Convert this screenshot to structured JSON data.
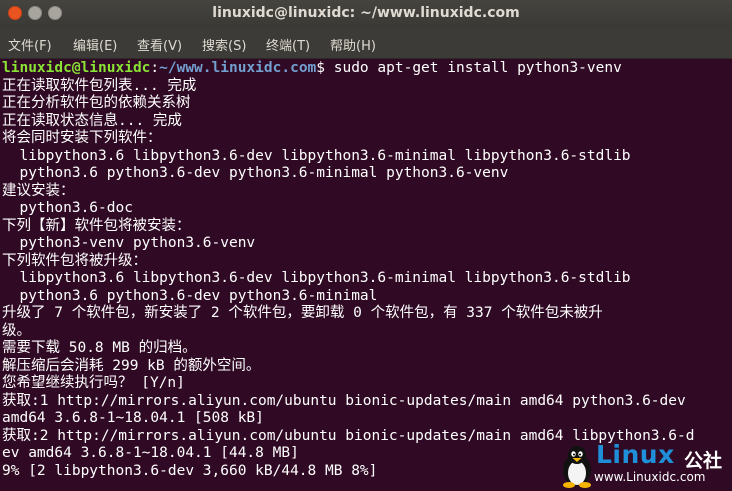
{
  "window": {
    "title": "linuxidc@linuxidc: ~/www.linuxidc.com"
  },
  "menu": [
    "文件(F)",
    "编辑(E)",
    "查看(V)",
    "搜索(S)",
    "终端(T)",
    "帮助(H)"
  ],
  "prompt": {
    "user": "linuxidc@linuxidc",
    "sep": ":",
    "path": "~/www.linuxidc.com",
    "dollar": "$",
    "command": " sudo apt-get install python3-venv"
  },
  "output": [
    "正在读取软件包列表... 完成",
    "正在分析软件包的依赖关系树",
    "正在读取状态信息... 完成",
    "将会同时安装下列软件：",
    "  libpython3.6 libpython3.6-dev libpython3.6-minimal libpython3.6-stdlib",
    "  python3.6 python3.6-dev python3.6-minimal python3.6-venv",
    "建议安装：",
    "  python3.6-doc",
    "下列【新】软件包将被安装：",
    "  python3-venv python3.6-venv",
    "下列软件包将被升级：",
    "  libpython3.6 libpython3.6-dev libpython3.6-minimal libpython3.6-stdlib",
    "  python3.6 python3.6-dev python3.6-minimal",
    "升级了 7 个软件包，新安装了 2 个软件包，要卸载 0 个软件包，有 337 个软件包未被升",
    "级。",
    "需要下载 50.8 MB 的归档。",
    "解压缩后会消耗 299 kB 的额外空间。",
    "您希望继续执行吗？ [Y/n]",
    "获取:1 http://mirrors.aliyun.com/ubuntu bionic-updates/main amd64 python3.6-dev",
    "amd64 3.6.8-1~18.04.1 [508 kB]",
    "获取:2 http://mirrors.aliyun.com/ubuntu bionic-updates/main amd64 libpython3.6-d",
    "ev amd64 3.6.8-1~18.04.1 [44.8 MB]",
    "9% [2 libpython3.6-dev 3,660 kB/44.8 MB 8%]"
  ],
  "watermark": {
    "brand": "Linux",
    "brand_cn": "公社",
    "url": "www.Linuxidc.com"
  },
  "colors": {
    "background": "#300a24",
    "user": "#8ae234",
    "path": "#729fcf",
    "accent": "#e95420"
  }
}
